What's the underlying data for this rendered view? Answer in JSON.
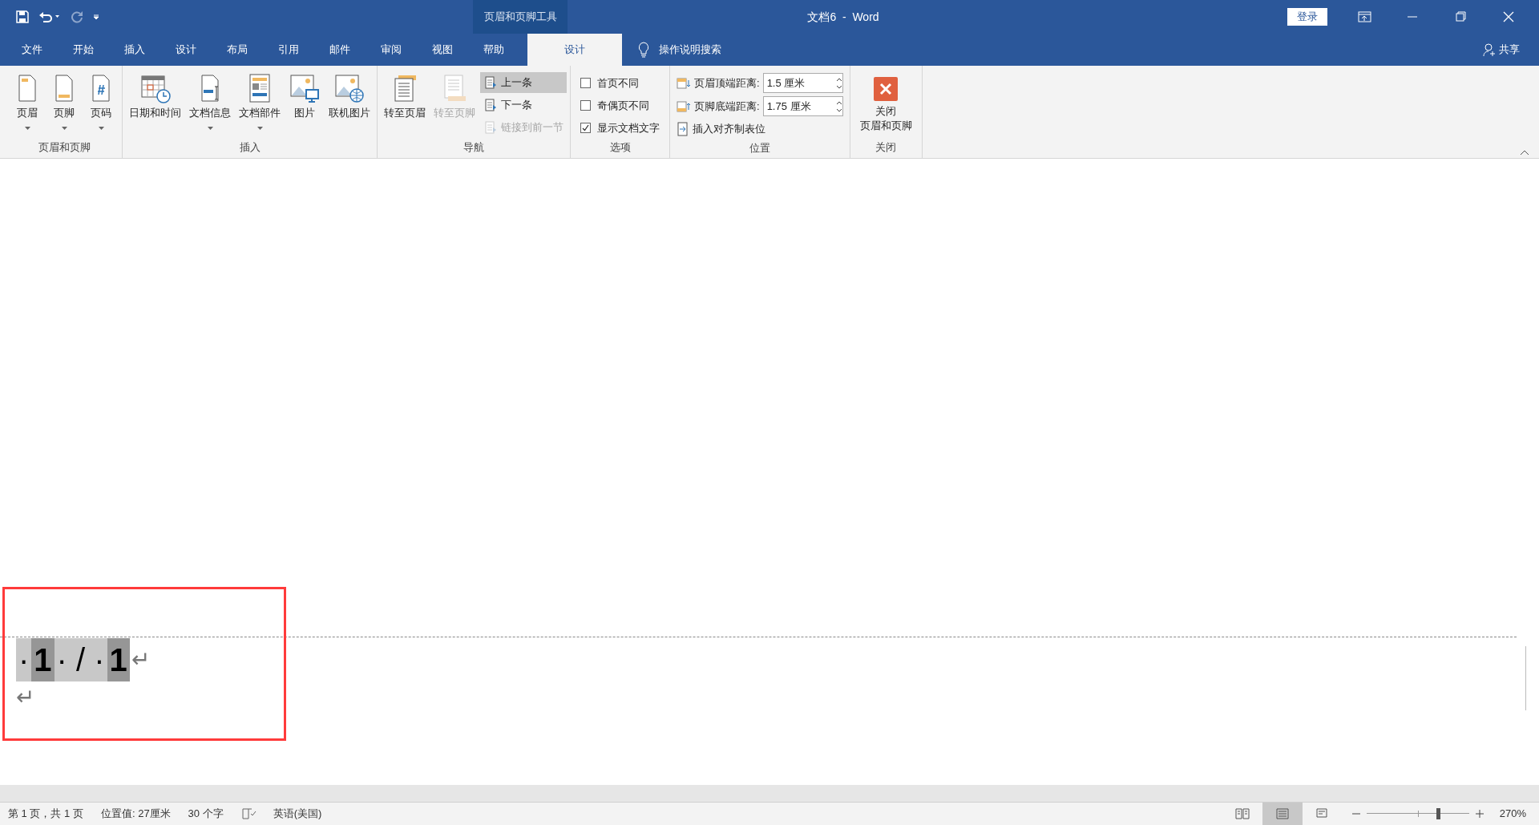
{
  "title_bar": {
    "context_label": "页眉和页脚工具",
    "title": "文档6  -  Word",
    "sign_in": "登录"
  },
  "tabs": [
    {
      "label": "文件",
      "selected": false
    },
    {
      "label": "开始",
      "selected": false
    },
    {
      "label": "插入",
      "selected": false
    },
    {
      "label": "设计",
      "selected": false
    },
    {
      "label": "布局",
      "selected": false
    },
    {
      "label": "引用",
      "selected": false
    },
    {
      "label": "邮件",
      "selected": false
    },
    {
      "label": "审阅",
      "selected": false
    },
    {
      "label": "视图",
      "selected": false
    },
    {
      "label": "帮助",
      "selected": false
    },
    {
      "label": "设计",
      "selected": true
    }
  ],
  "tell_me": "操作说明搜索",
  "share": "共享",
  "ribbon_groups": [
    {
      "label": "页眉和页脚",
      "items": [
        {
          "kind": "large",
          "label": "页眉",
          "dropdown": true,
          "disabled": false
        },
        {
          "kind": "large",
          "label": "页脚",
          "dropdown": true,
          "disabled": false
        },
        {
          "kind": "large",
          "label": "页码",
          "dropdown": true,
          "disabled": false
        }
      ]
    },
    {
      "label": "插入",
      "items": [
        {
          "kind": "large",
          "label": "日期和时间",
          "dropdown": false,
          "disabled": false
        },
        {
          "kind": "large",
          "label": "文档信息",
          "dropdown": true,
          "disabled": false
        },
        {
          "kind": "large",
          "label": "文档部件",
          "dropdown": true,
          "disabled": false
        },
        {
          "kind": "large",
          "label": "图片",
          "dropdown": false,
          "disabled": false
        },
        {
          "kind": "large",
          "label": "联机图片",
          "dropdown": false,
          "disabled": false
        }
      ]
    },
    {
      "label": "导航",
      "items": [
        {
          "kind": "large",
          "label": "转至页眉",
          "dropdown": false,
          "disabled": false
        },
        {
          "kind": "large",
          "label": "转至页脚",
          "dropdown": false,
          "disabled": true
        },
        {
          "kind": "stack",
          "rows": [
            {
              "label": "上一条",
              "disabled": false,
              "selected": true
            },
            {
              "label": "下一条",
              "disabled": false,
              "selected": false
            },
            {
              "label": "链接到前一节",
              "disabled": true,
              "selected": false
            }
          ]
        }
      ]
    },
    {
      "label": "选项",
      "items": [
        {
          "kind": "checks",
          "rows": [
            {
              "label": "首页不同",
              "checked": false
            },
            {
              "label": "奇偶页不同",
              "checked": false
            },
            {
              "label": "显示文档文字",
              "checked": true
            }
          ]
        }
      ]
    },
    {
      "label": "位置",
      "items": [
        {
          "kind": "position",
          "rows": [
            {
              "label": "页眉顶端距离:",
              "value": "1.5 厘米"
            },
            {
              "label": "页脚底端距离:",
              "value": "1.75 厘米"
            }
          ],
          "tab_button": "插入对齐制表位"
        }
      ]
    },
    {
      "label": "关闭",
      "items": [
        {
          "kind": "close",
          "lines": [
            "关闭",
            "页眉和页脚"
          ]
        }
      ]
    }
  ],
  "footer_field": [
    {
      "text": "·",
      "kind": "marks"
    },
    {
      "text": "1",
      "kind": "number"
    },
    {
      "text": "· / ·",
      "kind": "marks"
    },
    {
      "text": "1",
      "kind": "number"
    }
  ],
  "paragraph_marks": [
    "↵",
    "↵"
  ],
  "status_bar": {
    "items": [
      "第 1 页，共 1 页",
      "位置值: 27厘米",
      "30 个字"
    ],
    "language": "英语(美国)",
    "views": [
      {
        "selected": false
      },
      {
        "selected": true
      },
      {
        "selected": false
      }
    ],
    "zoom": {
      "level": 0.7
    },
    "zoom_text": "270%"
  }
}
